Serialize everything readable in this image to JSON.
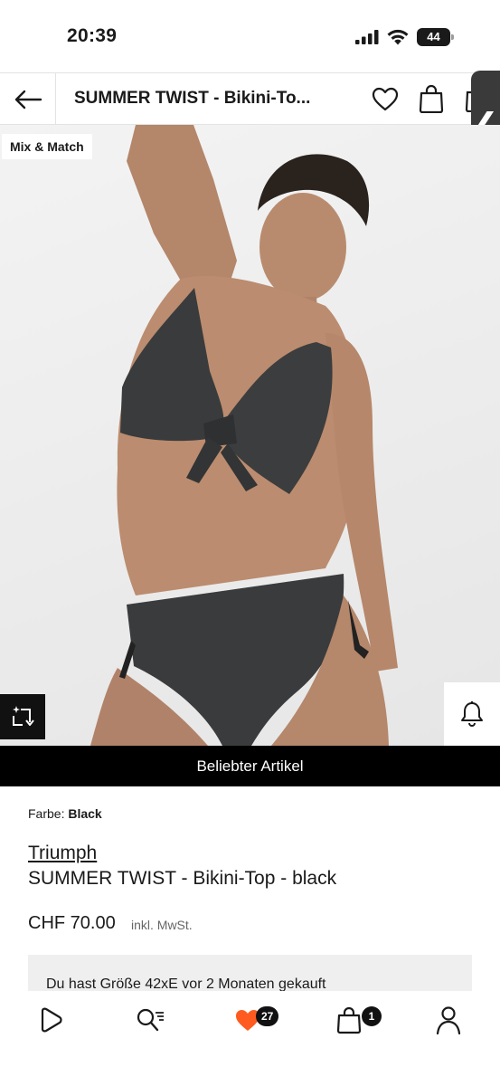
{
  "status_bar": {
    "time": "20:39",
    "battery": "44",
    "icons": [
      "signal-icon",
      "wifi-icon",
      "battery-icon"
    ]
  },
  "header": {
    "title": "SUMMER TWIST - Bikini-To...",
    "icons": [
      "back-arrow-icon",
      "heart-icon",
      "bag-icon"
    ]
  },
  "side_tab": {
    "glyph": "❮"
  },
  "product_image": {
    "badge": "Mix & Match",
    "icons": [
      "compare-icon",
      "bell-icon"
    ]
  },
  "popular_banner": {
    "label": "Beliebter Artikel"
  },
  "details": {
    "color_label": "Farbe:",
    "color_value": "Black",
    "brand": "Triumph",
    "name": "SUMMER TWIST - Bikini-Top - black",
    "price": "CHF 70.00",
    "vat": "inkl. MwSt.",
    "purchase_note": "Du hast Größe 42xE vor 2 Monaten gekauft"
  },
  "bottom_nav": {
    "items": [
      {
        "name": "home",
        "icon": "play-home-icon"
      },
      {
        "name": "search",
        "icon": "search-list-icon"
      },
      {
        "name": "wishlist",
        "icon": "heart-filled-icon",
        "badge": "27"
      },
      {
        "name": "bag",
        "icon": "bag-icon",
        "badge": "1"
      },
      {
        "name": "profile",
        "icon": "person-icon"
      }
    ]
  },
  "colors": {
    "accent_heart": "#ff5a1f",
    "banner": "#000000",
    "text": "#1a1a1a"
  }
}
